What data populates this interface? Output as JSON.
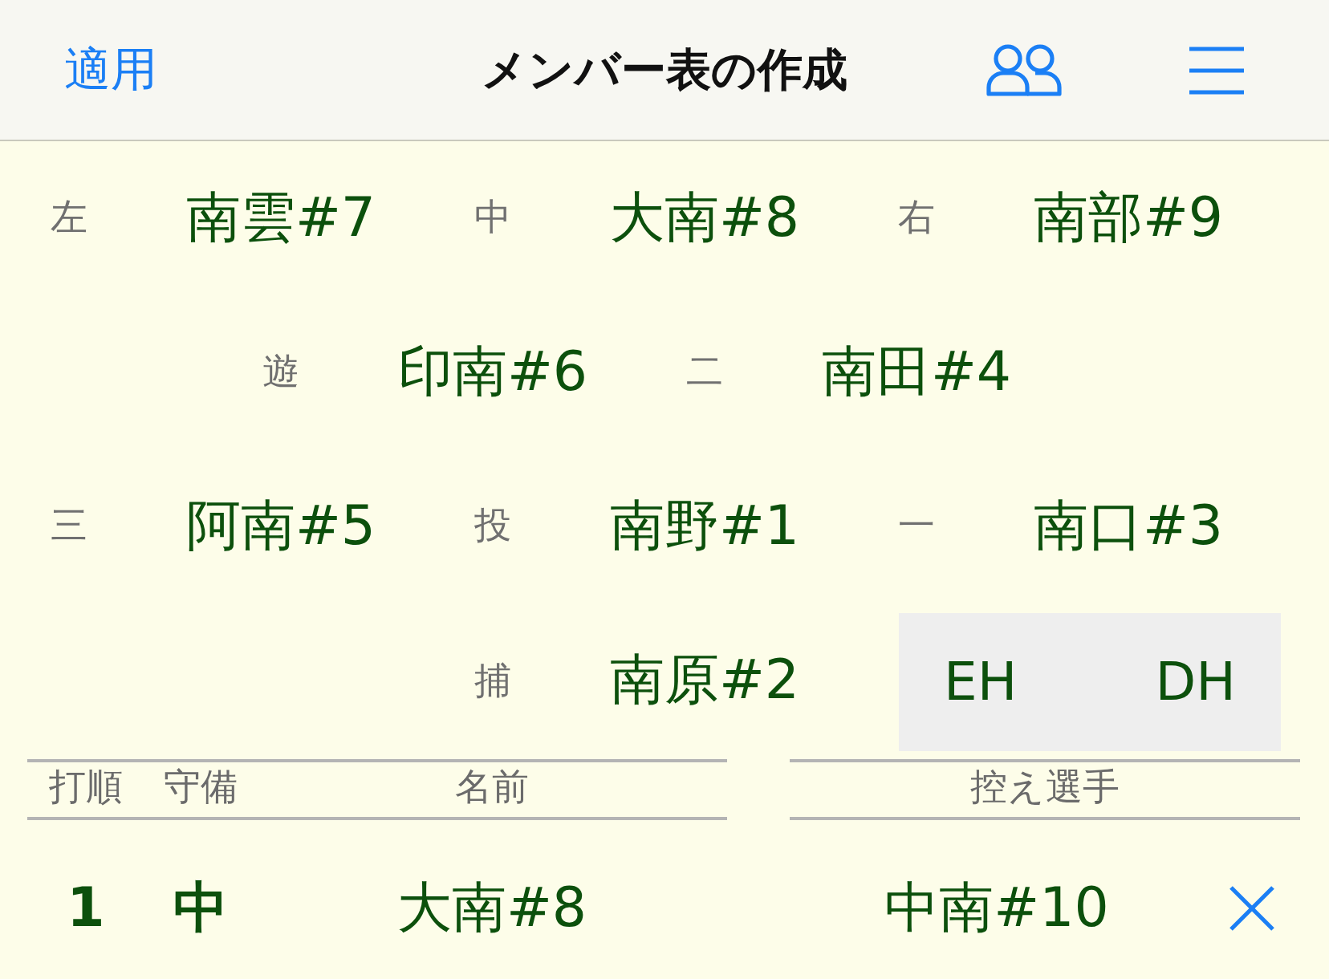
{
  "header": {
    "apply_button": "適用",
    "title": "メンバー表の作成"
  },
  "field": {
    "rows": [
      {
        "slots": [
          {
            "kind": "position",
            "label": "左",
            "player": "南雲#7"
          },
          {
            "kind": "position",
            "label": "中",
            "player": "大南#8"
          },
          {
            "kind": "position",
            "label": "右",
            "player": "南部#9"
          }
        ]
      },
      {
        "slots": [
          {
            "kind": "position",
            "label": "遊",
            "player": "印南#6"
          },
          {
            "kind": "position",
            "label": "二",
            "player": "南田#4"
          }
        ]
      },
      {
        "slots": [
          {
            "kind": "position",
            "label": "三",
            "player": "阿南#5"
          },
          {
            "kind": "position",
            "label": "投",
            "player": "南野#1"
          },
          {
            "kind": "position",
            "label": "一",
            "player": "南口#3"
          }
        ]
      },
      {
        "slots": [
          {
            "kind": "position",
            "label": "捕",
            "player": "南原#2"
          },
          {
            "kind": "dh_toggle",
            "options": [
              "EH",
              "DH"
            ]
          }
        ]
      }
    ]
  },
  "lineup": {
    "columns": [
      "打順",
      "守備",
      "名前"
    ],
    "rows": [
      {
        "order": "1",
        "position": "中",
        "name": "大南#8"
      }
    ]
  },
  "bench": {
    "title": "控え選手",
    "players": [
      {
        "name": "中南#10"
      }
    ]
  }
}
